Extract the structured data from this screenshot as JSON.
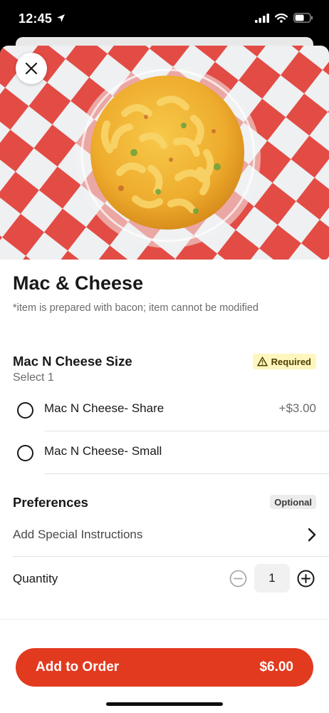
{
  "status": {
    "time": "12:45",
    "icons": [
      "location-arrow-icon",
      "signal-icon",
      "wifi-icon",
      "battery-icon"
    ]
  },
  "item": {
    "image_icon": "mac-and-cheese-photo",
    "title": "Mac & Cheese",
    "description": "*item is prepared with bacon; item cannot be modified"
  },
  "size_section": {
    "title": "Mac N Cheese Size",
    "subtitle": "Select 1",
    "badge": "Required",
    "badge_icon": "warning-triangle-icon",
    "options": [
      {
        "label": "Mac N Cheese- Share",
        "price": "+$3.00"
      },
      {
        "label": "Mac N Cheese- Small",
        "price": ""
      }
    ]
  },
  "preferences": {
    "title": "Preferences",
    "badge": "Optional",
    "instructions_label": "Add Special Instructions"
  },
  "quantity": {
    "label": "Quantity",
    "value": "1"
  },
  "cta": {
    "label": "Add to Order",
    "price": "$6.00"
  },
  "colors": {
    "brand_red": "#e23a1f",
    "required_bg": "#fff6bf",
    "optional_bg": "#ececec"
  }
}
